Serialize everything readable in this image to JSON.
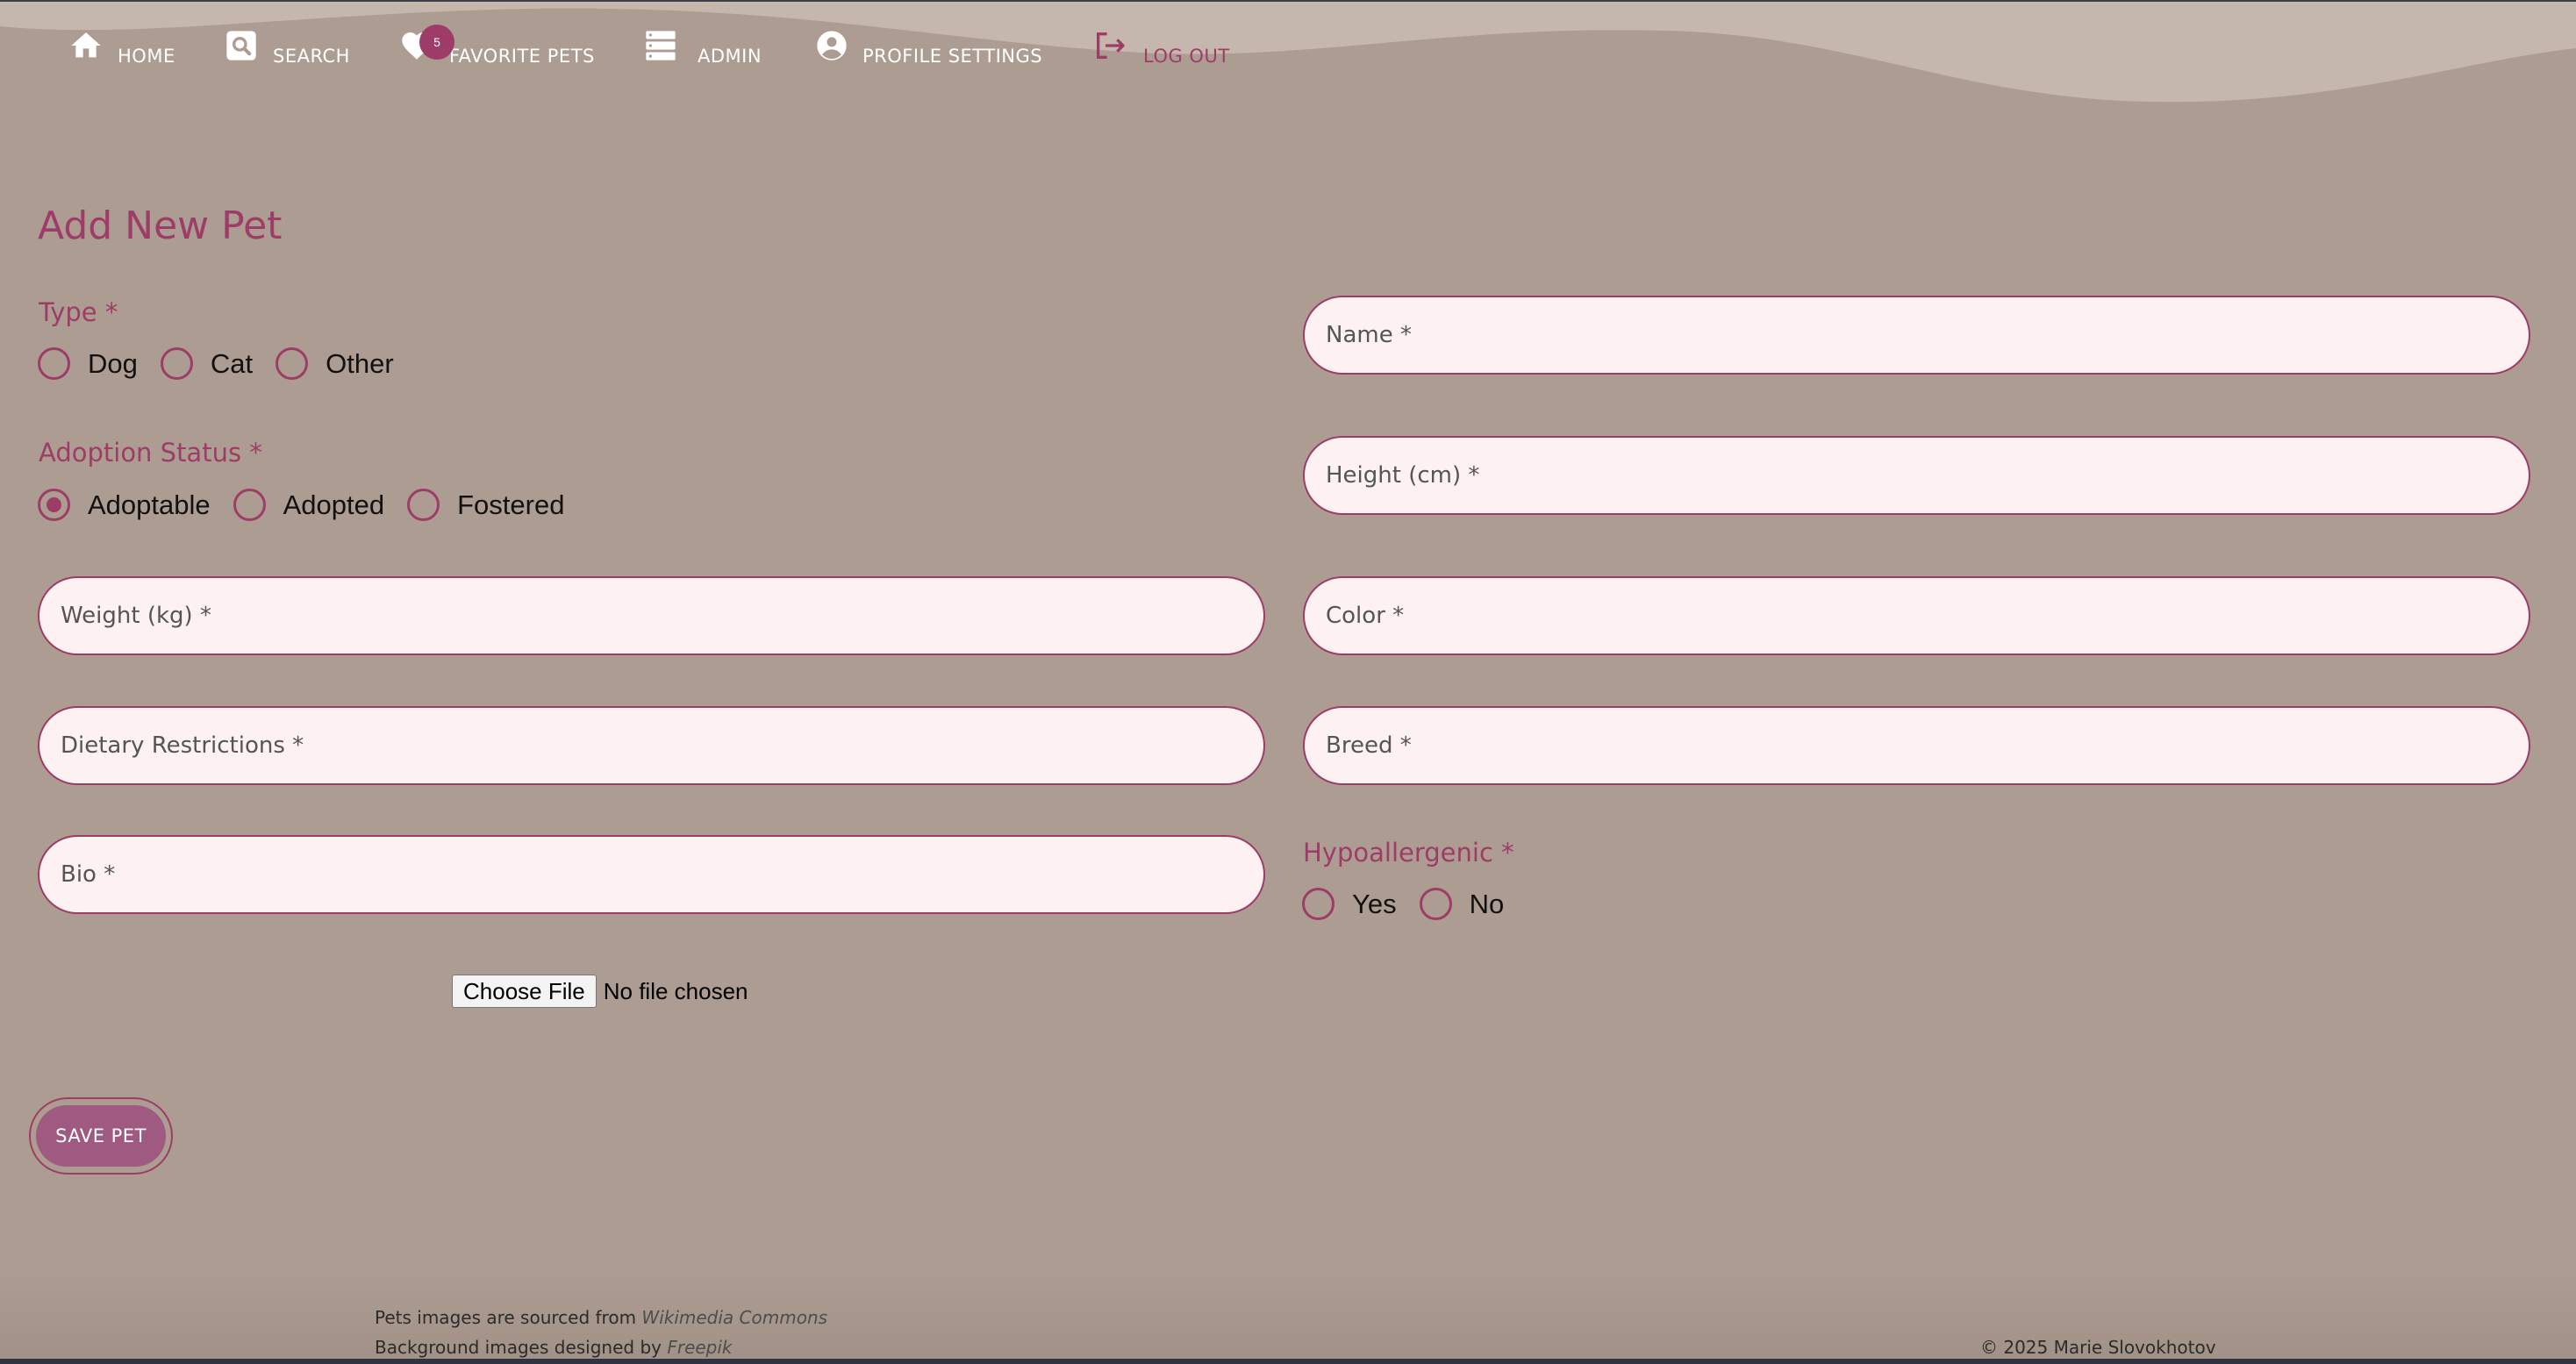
{
  "nav": {
    "home": "HOME",
    "search": "SEARCH",
    "favorites": "FAVORITE PETS",
    "favorites_count": "5",
    "admin": "ADMIN",
    "profile": "PROFILE SETTINGS",
    "logout": "LOG OUT"
  },
  "form": {
    "title": "Add New Pet",
    "type": {
      "label": "Type *",
      "options": [
        "Dog",
        "Cat",
        "Other"
      ],
      "selected": null
    },
    "adoption_status": {
      "label": "Adoption Status *",
      "options": [
        "Adoptable",
        "Adopted",
        "Fostered"
      ],
      "selected": "Adoptable"
    },
    "hypoallergenic": {
      "label": "Hypoallergenic *",
      "options": [
        "Yes",
        "No"
      ],
      "selected": null
    },
    "fields": {
      "name": "Name *",
      "height": "Height (cm) *",
      "weight": "Weight (kg) *",
      "color": "Color *",
      "dietary": "Dietary Restrictions *",
      "breed": "Breed *",
      "bio": "Bio *"
    },
    "file": {
      "button": "Choose File",
      "status": "No file chosen"
    },
    "save": "SAVE PET"
  },
  "footer": {
    "images_text": "Pets images are sourced from ",
    "images_source": "Wikimedia Commons",
    "bg_text": "Background images designed by ",
    "bg_source": "Freepik",
    "copyright": "© 2025 Marie Slovokhotov"
  },
  "colors": {
    "background": "#ad9c91",
    "accent": "#9e3c68",
    "field_bg": "#fdf1f2"
  }
}
